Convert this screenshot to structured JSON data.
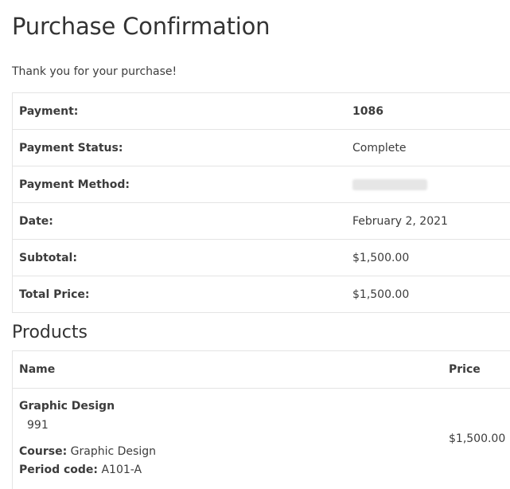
{
  "page": {
    "title": "Purchase Confirmation",
    "thanks": "Thank you for your purchase!"
  },
  "receipt": {
    "rows": [
      {
        "label": "Payment:",
        "value": "1086"
      },
      {
        "label": "Payment Status:",
        "value": "Complete"
      },
      {
        "label": "Payment Method:",
        "value": ""
      },
      {
        "label": "Date:",
        "value": "February 2, 2021"
      },
      {
        "label": "Subtotal:",
        "value": "$1,500.00"
      },
      {
        "label": "Total Price:",
        "value": "$1,500.00"
      }
    ]
  },
  "products": {
    "heading": "Products",
    "columns": {
      "name": "Name",
      "price": "Price"
    },
    "items": [
      {
        "name": "Graphic Design",
        "id": "991",
        "course_label": "Course:",
        "course_value": "Graphic Design",
        "period_label": "Period code:",
        "period_value": "A101-A",
        "price": "$1,500.00"
      }
    ]
  }
}
